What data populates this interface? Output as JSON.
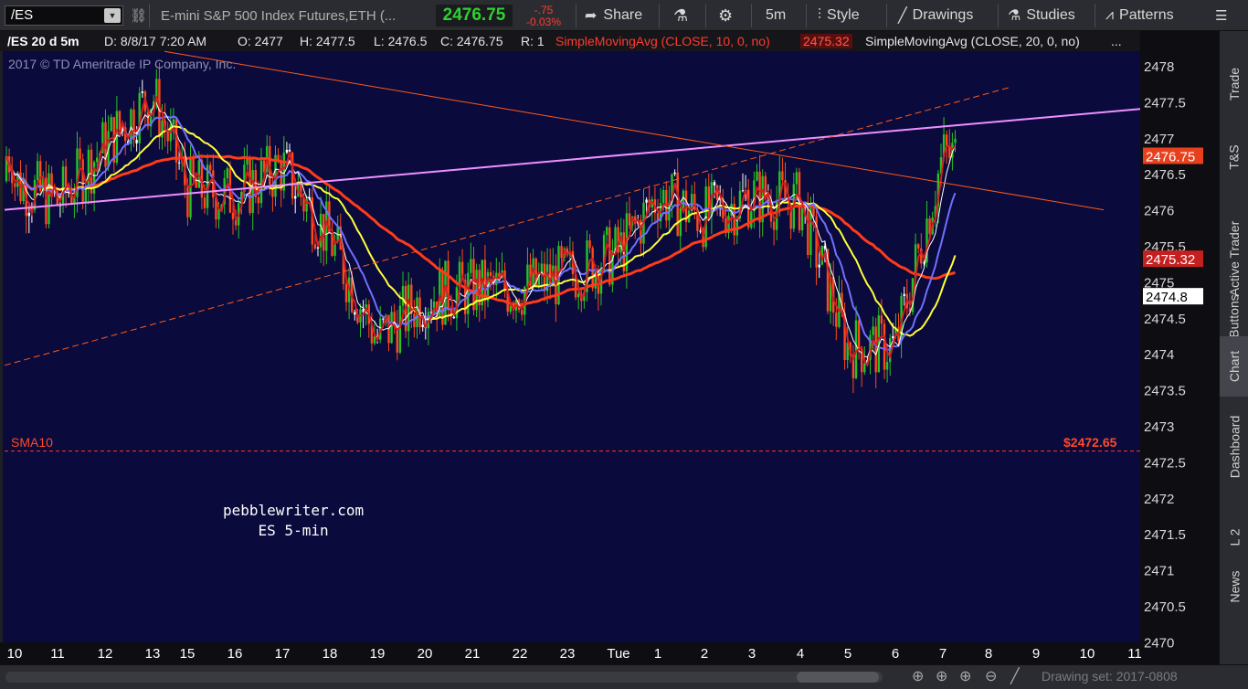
{
  "toolbar": {
    "symbol": "/ES",
    "description": "E-mini S&P 500 Index Futures,ETH (...",
    "last_price": "2476.75",
    "change": "-.75",
    "change_pct": "-0.03%",
    "share_label": "Share",
    "interval_label": "5m",
    "style_label": "Style",
    "drawings_label": "Drawings",
    "studies_label": "Studies",
    "patterns_label": "Patterns"
  },
  "infobar": {
    "symbol_period": "/ES 20 d 5m",
    "date": "D: 8/8/17 7:20 AM",
    "open": "O: 2477",
    "high": "H: 2477.5",
    "low": "L: 2476.5",
    "close": "C: 2476.75",
    "range": "R: 1",
    "sma10_label": "SimpleMovingAvg (CLOSE, 10, 0, no)",
    "sma10_value": "2475.32",
    "sma20_label": "SimpleMovingAvg (CLOSE, 20, 0, no)",
    "more": "..."
  },
  "copyright": "2017 © TD Ameritrade IP Company, Inc.",
  "watermark": {
    "line1": "pebblewriter.com",
    "line2": "ES 5-min"
  },
  "sma_level": {
    "label": "SMA10",
    "value": "$2472.65",
    "price": 2472.65
  },
  "y_price_labels": [
    {
      "text": "2476.75",
      "price": 2476.75,
      "bg": "#e8401c",
      "color": "#ffffff"
    },
    {
      "text": "2475.32",
      "price": 2475.32,
      "bg": "#c42020",
      "color": "#ffffff"
    },
    {
      "text": "2474.8",
      "price": 2474.8,
      "bg": "#ffffff",
      "color": "#000000"
    }
  ],
  "side_tabs": [
    "Trade",
    "T&S",
    "Active Trader",
    "Buttons",
    "Chart",
    "Dashboard",
    "L 2",
    "News"
  ],
  "active_side_tab": "Chart",
  "bottom": {
    "drawing_set": "Drawing set: 2017-0808"
  },
  "colors": {
    "plot_bg": "#0a0a3c",
    "up": "#27c227",
    "down": "#ff4a1a",
    "doji": "#ffffff",
    "sma_slow": "#ff3b1a",
    "sma_mid": "#ffff3a",
    "sma_blue": "#7070ff",
    "sma_fast": "#d42020",
    "sma_white": "#ffffff",
    "trend_magenta": "#ee90ff",
    "trend_orange": "#ff5a1a",
    "sma_level": "#ff3b1a"
  },
  "chart_data": {
    "type": "line",
    "title": "/ES 20 d 5m",
    "ylim": [
      2470,
      2478.2
    ],
    "y_ticks": [
      "2478",
      "2477.5",
      "2477",
      "2476.5",
      "2476",
      "2475.5",
      "2475",
      "2474.5",
      "2474",
      "2473.5",
      "2473",
      "2472.5",
      "2472",
      "2471.5",
      "2471",
      "2470.5",
      "2470"
    ],
    "x_ticks": [
      "10",
      "11",
      "12",
      "13",
      "15",
      "16",
      "17",
      "18",
      "19",
      "20",
      "21",
      "22",
      "23",
      "Tue",
      "1",
      "2",
      "3",
      "4",
      "5",
      "6",
      "7",
      "8",
      "9",
      "10",
      "11"
    ],
    "close_path": [
      {
        "x": "10",
        "y": 2476.4
      },
      {
        "x": "11",
        "y": 2476.1
      },
      {
        "x": "12",
        "y": 2476.9
      },
      {
        "x": "13",
        "y": 2477.6
      },
      {
        "x": "15",
        "y": 2476.3
      },
      {
        "x": "16",
        "y": 2476.2
      },
      {
        "x": "17",
        "y": 2476.6
      },
      {
        "x": "18",
        "y": 2475.6
      },
      {
        "x": "19",
        "y": 2474.2
      },
      {
        "x": "20",
        "y": 2474.8
      },
      {
        "x": "21",
        "y": 2474.9
      },
      {
        "x": "22",
        "y": 2474.9
      },
      {
        "x": "23",
        "y": 2475.1
      },
      {
        "x": "Tue",
        "y": 2475.4
      },
      {
        "x": "1",
        "y": 2476.2
      },
      {
        "x": "2",
        "y": 2475.9
      },
      {
        "x": "3",
        "y": 2476.2
      },
      {
        "x": "4",
        "y": 2476.1
      },
      {
        "x": "5",
        "y": 2474.1
      },
      {
        "x": "6",
        "y": 2474.1
      },
      {
        "x": "7",
        "y": 2476.75
      }
    ],
    "series": [
      {
        "name": "SimpleMovingAvg (CLOSE, 10, 0, no)",
        "last": 2475.32
      },
      {
        "name": "SimpleMovingAvg (CLOSE, 20, 0, no)",
        "last": 2474.8
      }
    ],
    "horizontal_line": {
      "label": "SMA10",
      "value": 2472.65
    },
    "grid": false,
    "annotations": [
      "pebblewriter.com",
      "ES 5-min"
    ]
  }
}
